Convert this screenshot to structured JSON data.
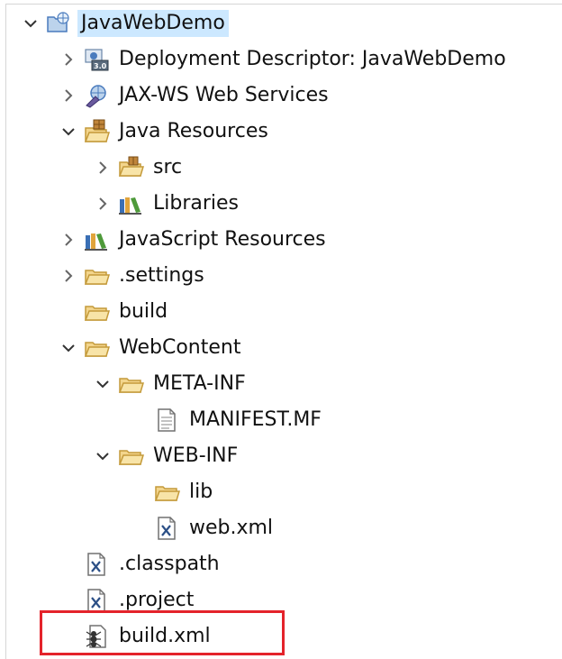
{
  "tree": {
    "items": [
      {
        "label": "JavaWebDemo",
        "icon": "web-project-icon",
        "level": 0,
        "twisty": "expanded",
        "selected": true
      },
      {
        "label": "Deployment Descriptor: JavaWebDemo",
        "icon": "deployment-descriptor-icon",
        "level": 1,
        "twisty": "collapsed"
      },
      {
        "label": "JAX-WS Web Services",
        "icon": "web-services-icon",
        "level": 1,
        "twisty": "collapsed"
      },
      {
        "label": "Java Resources",
        "icon": "java-resources-icon",
        "level": 1,
        "twisty": "expanded"
      },
      {
        "label": "src",
        "icon": "package-folder-icon",
        "level": 2,
        "twisty": "collapsed"
      },
      {
        "label": "Libraries",
        "icon": "libraries-icon",
        "level": 2,
        "twisty": "collapsed"
      },
      {
        "label": "JavaScript Resources",
        "icon": "libraries-icon",
        "level": 1,
        "twisty": "collapsed"
      },
      {
        "label": ".settings",
        "icon": "folder-icon",
        "level": 1,
        "twisty": "collapsed"
      },
      {
        "label": "build",
        "icon": "folder-icon",
        "level": 1,
        "twisty": "none"
      },
      {
        "label": "WebContent",
        "icon": "folder-icon",
        "level": 1,
        "twisty": "expanded"
      },
      {
        "label": "META-INF",
        "icon": "folder-icon",
        "level": 2,
        "twisty": "expanded"
      },
      {
        "label": "MANIFEST.MF",
        "icon": "text-file-icon",
        "level": 3,
        "twisty": "none"
      },
      {
        "label": "WEB-INF",
        "icon": "folder-icon",
        "level": 2,
        "twisty": "expanded"
      },
      {
        "label": "lib",
        "icon": "folder-icon",
        "level": 3,
        "twisty": "none"
      },
      {
        "label": "web.xml",
        "icon": "xml-file-icon",
        "level": 3,
        "twisty": "none"
      },
      {
        "label": ".classpath",
        "icon": "xml-file-icon",
        "level": 1,
        "twisty": "none"
      },
      {
        "label": ".project",
        "icon": "xml-file-icon",
        "level": 1,
        "twisty": "none"
      },
      {
        "label": "build.xml",
        "icon": "ant-build-file-icon",
        "level": 1,
        "twisty": "none"
      }
    ]
  },
  "colors": {
    "selection": "#cce8ff",
    "highlight_border": "#e4232b",
    "folder_fill": "#f3d58c",
    "folder_stroke": "#c49a3a"
  }
}
